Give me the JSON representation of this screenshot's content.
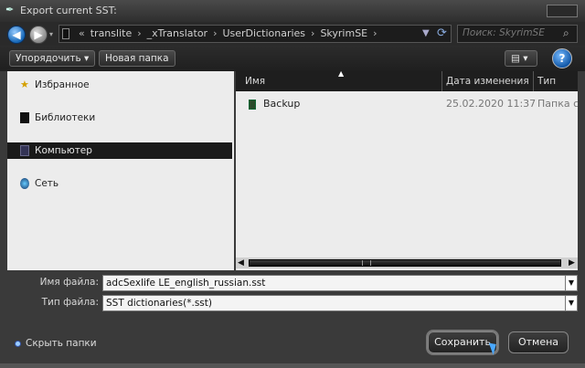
{
  "window": {
    "title": "Export current SST:"
  },
  "address": {
    "crumbs": [
      "translite",
      "_xTranslator",
      "UserDictionaries",
      "SkyrimSE"
    ],
    "separator": "›",
    "lead": "«"
  },
  "search": {
    "placeholder": "Поиск: SkyrimSE"
  },
  "toolbar": {
    "organize_label": "Упорядочить ▾",
    "newfolder_label": "Новая папка",
    "views_label": "▤ ▾",
    "help_label": "?"
  },
  "nav": {
    "favorites": "Избранное",
    "libraries": "Библиотеки",
    "computer": "Компьютер",
    "network": "Сеть"
  },
  "columns": {
    "name": "Имя",
    "date": "Дата изменения",
    "type": "Тип"
  },
  "rows": [
    {
      "name": "Backup",
      "date": "25.02.2020 11:37",
      "type": "Папка с файл"
    }
  ],
  "form": {
    "fname_label": "Имя файла:",
    "fname_value": "adcSexlife LE_english_russian.sst",
    "ftype_label": "Тип файла:",
    "ftype_value": "SST dictionaries(*.sst)"
  },
  "footer": {
    "hide_folders": "Скрыть папки",
    "save_label": "Сохранить",
    "cancel_label": "Отмена"
  },
  "colors": {
    "accent": "#1566b5",
    "selection": "#1a1a1a"
  }
}
